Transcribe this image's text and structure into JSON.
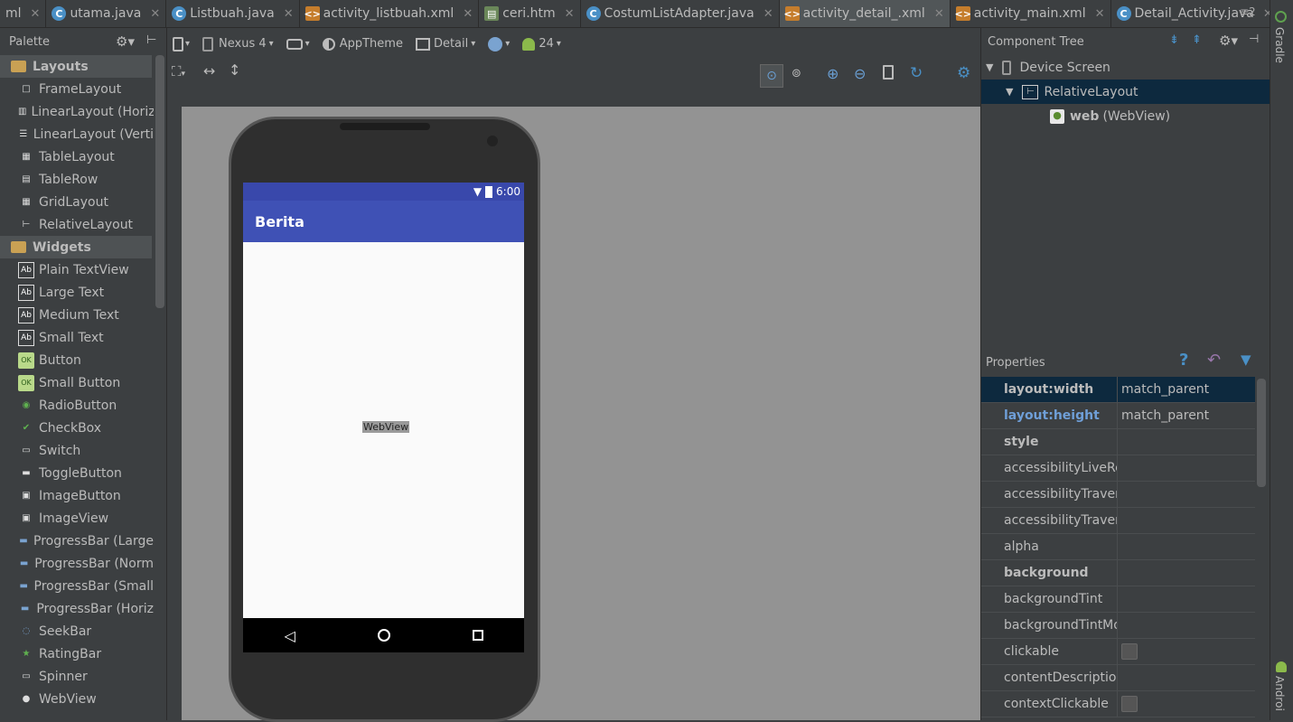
{
  "tabs": [
    {
      "label": "ml",
      "icon": "xml-file-icon"
    },
    {
      "label": "utama.java",
      "icon": "class-icon"
    },
    {
      "label": "Listbuah.java",
      "icon": "class-icon"
    },
    {
      "label": "activity_listbuah.xml",
      "icon": "layout-file-icon"
    },
    {
      "label": "ceri.htm",
      "icon": "html-file-icon"
    },
    {
      "label": "CostumListAdapter.java",
      "icon": "class-icon"
    },
    {
      "label": "activity_detail_.xml",
      "icon": "layout-file-icon"
    },
    {
      "label": "activity_main.xml",
      "icon": "layout-file-icon"
    },
    {
      "label": "Detail_Activity.java",
      "icon": "class-icon"
    }
  ],
  "tab_overflow": "≡2",
  "side_strip": {
    "top": "Gradle",
    "bottom": "Androi"
  },
  "palette": {
    "title": "Palette",
    "categories": [
      {
        "label": "Layouts",
        "items": [
          "FrameLayout",
          "LinearLayout (Horiz",
          "LinearLayout (Verti",
          "TableLayout",
          "TableRow",
          "GridLayout",
          "RelativeLayout"
        ]
      },
      {
        "label": "Widgets",
        "items": [
          "Plain TextView",
          "Large Text",
          "Medium Text",
          "Small Text",
          "Button",
          "Small Button",
          "RadioButton",
          "CheckBox",
          "Switch",
          "ToggleButton",
          "ImageButton",
          "ImageView",
          "ProgressBar (Large",
          "ProgressBar (Norm",
          "ProgressBar (Small",
          "ProgressBar (Horiz",
          "SeekBar",
          "RatingBar",
          "Spinner",
          "WebView"
        ]
      }
    ]
  },
  "toolbar": {
    "device": "Nexus 4",
    "theme": "AppTheme",
    "activity": "Detail",
    "api": "24"
  },
  "phone": {
    "time": "6:00",
    "app_title": "Berita",
    "webview_label": "WebView"
  },
  "component_tree": {
    "title": "Component Tree",
    "device": "Device Screen",
    "layout": "RelativeLayout",
    "child_id": "web",
    "child_type": "(WebView)"
  },
  "properties": {
    "title": "Properties",
    "rows": [
      {
        "name": "layout:width",
        "value": "match_parent"
      },
      {
        "name": "layout:height",
        "value": "match_parent"
      },
      {
        "name": "style",
        "value": ""
      },
      {
        "name": "accessibilityLiveRegion",
        "value": ""
      },
      {
        "name": "accessibilityTraversalAfter",
        "value": ""
      },
      {
        "name": "accessibilityTraversalBefore",
        "value": ""
      },
      {
        "name": "alpha",
        "value": ""
      },
      {
        "name": "background",
        "value": ""
      },
      {
        "name": "backgroundTint",
        "value": ""
      },
      {
        "name": "backgroundTintMode",
        "value": ""
      },
      {
        "name": "clickable",
        "value": ""
      },
      {
        "name": "contentDescription",
        "value": ""
      },
      {
        "name": "contextClickable",
        "value": ""
      }
    ]
  },
  "colors": {
    "accent": "#3f51b5",
    "status": "#3948ab",
    "selection": "#0d293e"
  }
}
